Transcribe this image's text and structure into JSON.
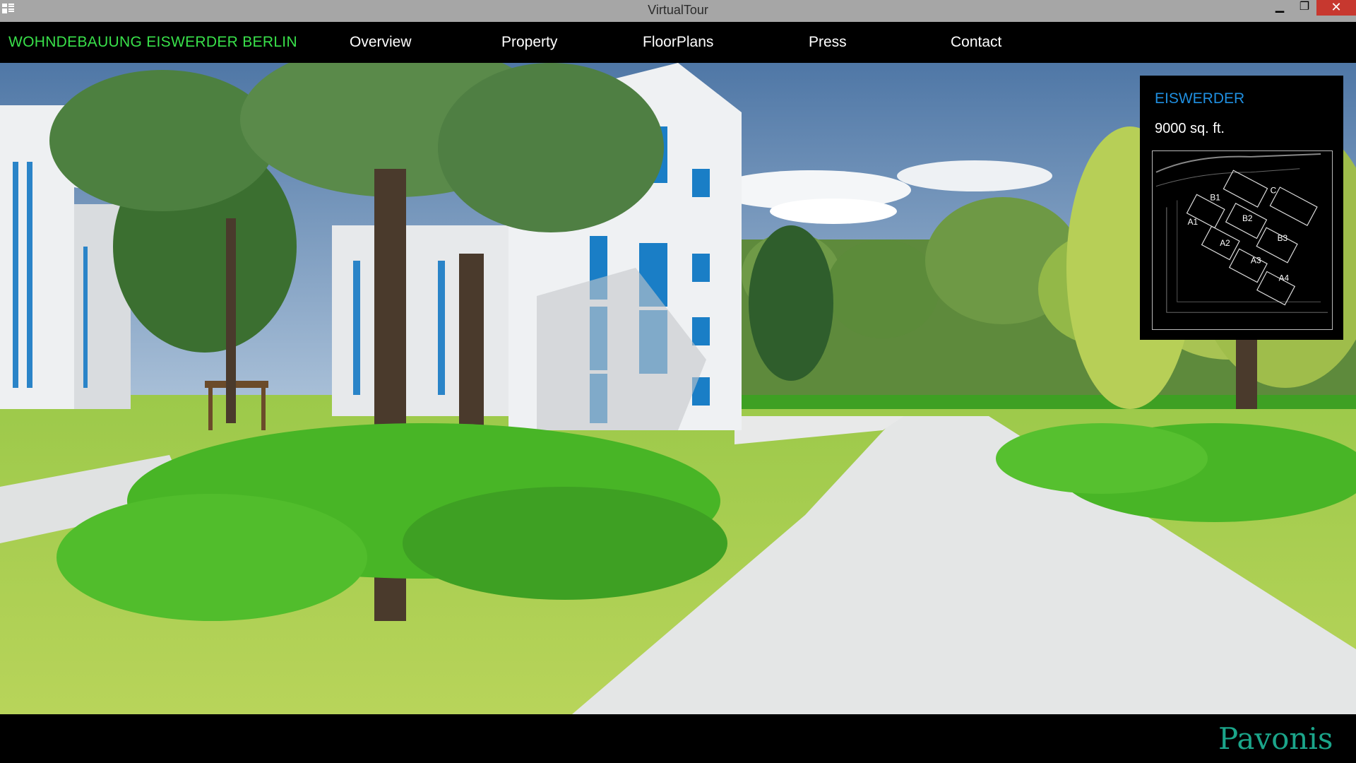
{
  "window": {
    "title": "VirtualTour",
    "minimize": "▁",
    "maximize": "❐",
    "close": "✕"
  },
  "nav": {
    "brand": "WOHNDEBAUUNG EISWERDER BERLIN",
    "items": [
      "Overview",
      "Property",
      "FloorPlans",
      "Press",
      "Contact"
    ]
  },
  "info": {
    "title": "EISWERDER",
    "area": "9000 sq. ft.",
    "plan_labels": [
      "B1",
      "C",
      "B2",
      "A1",
      "B3",
      "A2",
      "A3",
      "A4"
    ]
  },
  "footer": {
    "logo": "Pavonis"
  },
  "colors": {
    "brand": "#39e04a",
    "accent": "#1f8fe0",
    "logo": "#1ba58a",
    "close": "#c7382f"
  }
}
